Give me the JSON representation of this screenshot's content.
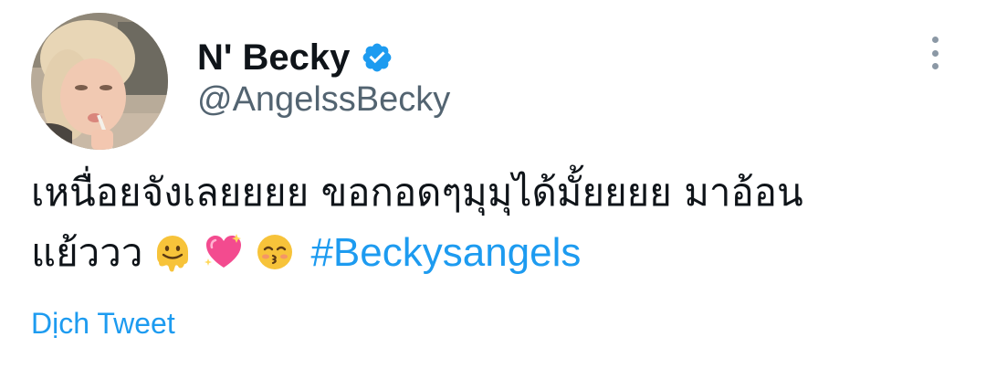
{
  "author": {
    "display_name": "N' Becky",
    "handle": "@AngelssBecky",
    "verified": true,
    "avatar": "profile-photo"
  },
  "tweet": {
    "line1": "เหนื่อยจังเลยยยย ขอกอดๆมุมุได้มั้ยยยย มาอ้อน",
    "line2_text": "แย้ววว",
    "emojis": [
      "melting-face-emoji",
      "sparkling-heart-emoji",
      "kissing-face-emoji"
    ],
    "hashtag": "#Beckysangels"
  },
  "actions": {
    "translate_label": "Dịch Tweet",
    "more_icon": "more-vertical-icon"
  },
  "colors": {
    "accent": "#1d9bf0",
    "secondary_text": "#536471",
    "primary_text": "#0f1419",
    "verified_badge": "#1d9bf0"
  }
}
